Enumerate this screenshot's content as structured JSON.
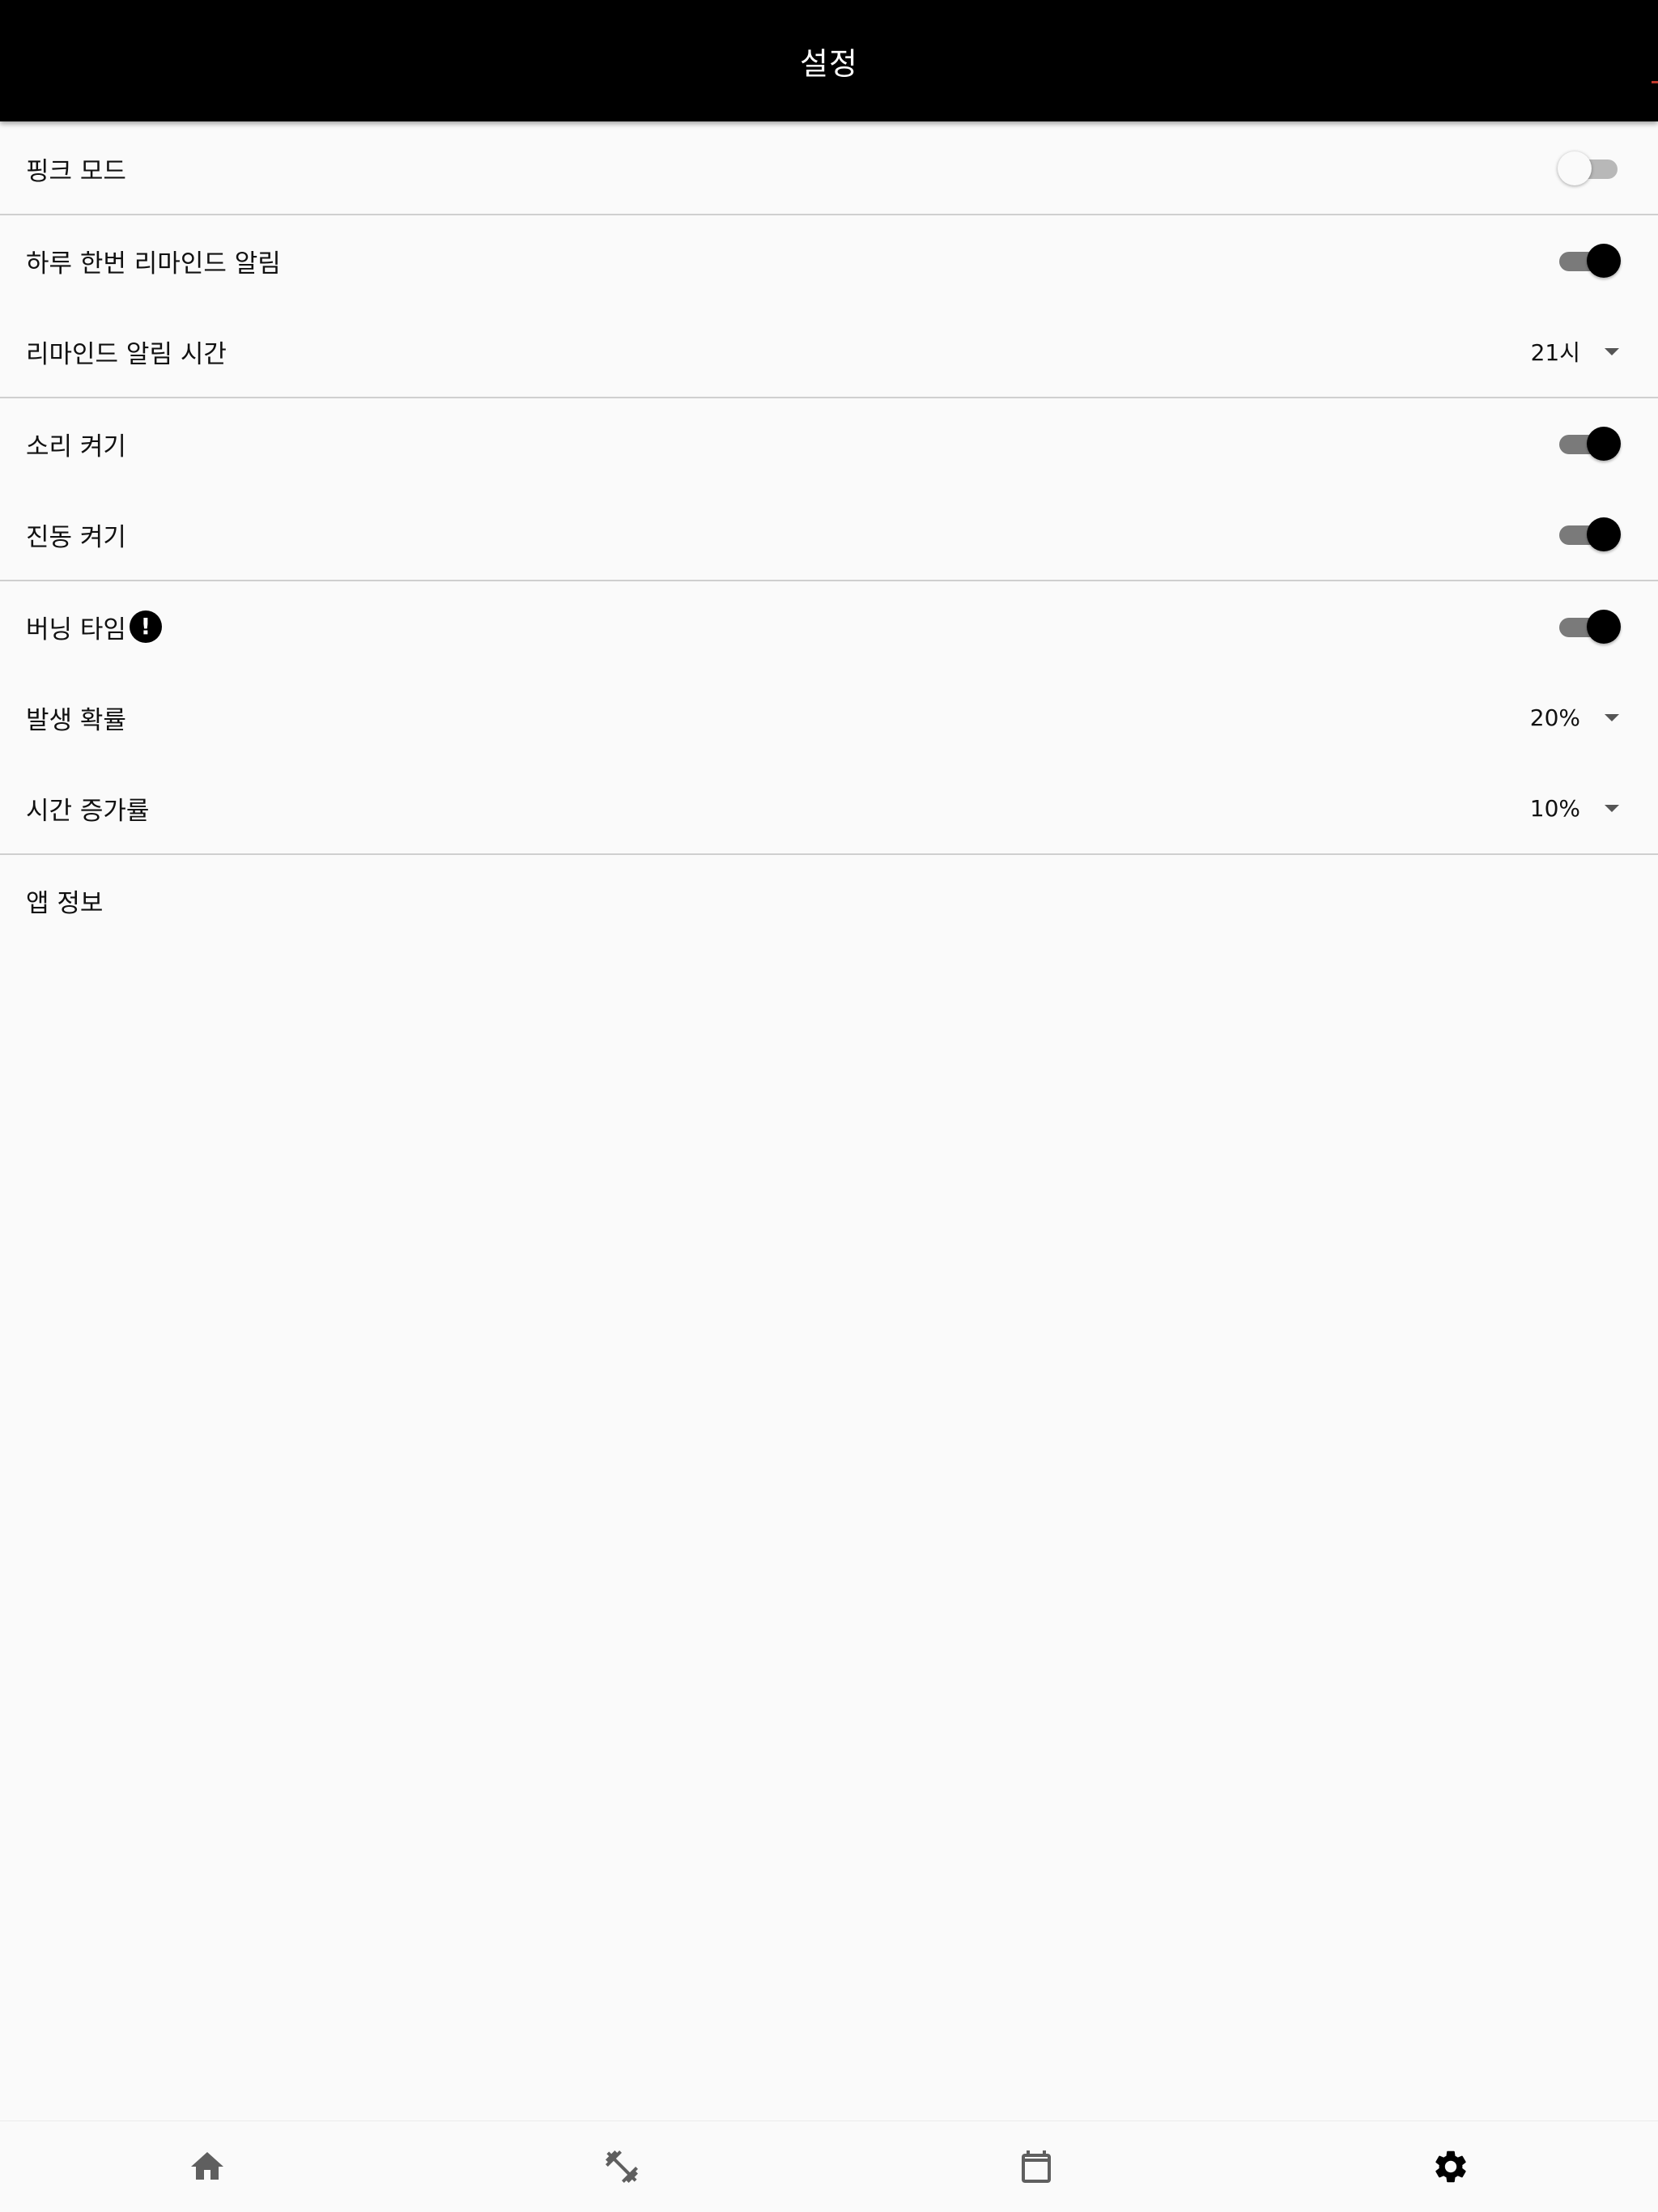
{
  "appbar": {
    "title": "설정"
  },
  "settings": {
    "pink_mode": {
      "label": "핑크 모드",
      "enabled": false
    },
    "daily_reminder": {
      "label": "하루 한번 리마인드 알림",
      "enabled": true
    },
    "reminder_time": {
      "label": "리마인드 알림 시간",
      "value": "21시"
    },
    "sound": {
      "label": "소리 켜기",
      "enabled": true
    },
    "vibration": {
      "label": "진동 켜기",
      "enabled": true
    },
    "burning_time": {
      "label": "버닝 타임",
      "info_icon": "!",
      "enabled": true
    },
    "probability": {
      "label": "발생 확률",
      "value": "20%"
    },
    "time_increase": {
      "label": "시간 증가률",
      "value": "10%"
    },
    "app_info": {
      "label": "앱 정보"
    }
  },
  "bottom_nav": {
    "items": [
      {
        "icon": "home-icon"
      },
      {
        "icon": "dumbbell-icon"
      },
      {
        "icon": "calendar-icon"
      },
      {
        "icon": "gear-icon",
        "active": true
      }
    ]
  },
  "colors": {
    "appbar_bg": "#000000",
    "background": "#fafafa",
    "divider": "#cfcfcf",
    "switch_thumb_on": "#000000",
    "switch_track_on": "#7a7a7a",
    "nav_icon": "#5f5f5f",
    "nav_icon_active": "#000000"
  }
}
